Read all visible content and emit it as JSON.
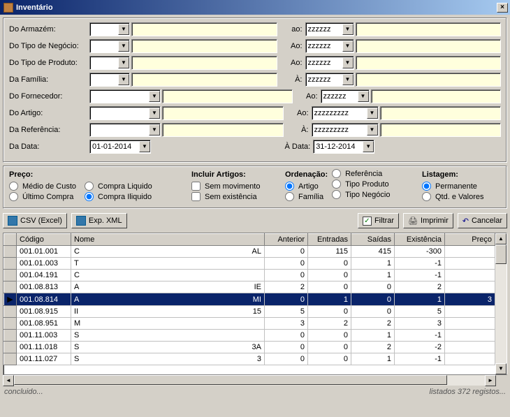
{
  "window": {
    "title": "Inventário"
  },
  "filters": {
    "labels": {
      "armazem": "Do Armazém:",
      "tipo_negocio": "Do Tipo de Negócio:",
      "tipo_produto": "Do Tipo de Produto:",
      "familia": "Da Família:",
      "fornecedor": "Do Fornecedor:",
      "artigo": "Do Artigo:",
      "referencia": "Da Referência:",
      "data_de": "Da Data:",
      "data_a": "À Data:"
    },
    "to_labels": {
      "ao": "ao:",
      "Ao": "Ao:",
      "A": "À:"
    },
    "z6": "zzzzzz",
    "z9": "zzzzzzzzz",
    "data_de_val": "01-01-2014",
    "data_a_val": "31-12-2014"
  },
  "options": {
    "preco": {
      "head": "Preço:",
      "medio": "Médio de Custo",
      "ultimo": "Último Compra",
      "compra_liq": "Compra Liquido",
      "compra_iliq": "Compra Iliquido",
      "selected": "compra_iliq"
    },
    "incluir": {
      "head": "Incluir Artigos:",
      "sem_movimento": "Sem movimento",
      "sem_existencia": "Sem existência"
    },
    "ordenacao": {
      "head": "Ordenação:",
      "artigo": "Artigo",
      "familia": "Família",
      "referencia": "Referência",
      "tipo_produto": "Tipo Produto",
      "tipo_negocio": "Tipo Negócio",
      "selected": "artigo"
    },
    "listagem": {
      "head": "Listagem:",
      "permanente": "Permanente",
      "qtd_val": "Qtd. e Valores",
      "selected": "permanente"
    }
  },
  "buttons": {
    "csv": "CSV (Excel)",
    "xml": "Exp. XML",
    "filtrar": "Filtrar",
    "imprimir": "Imprimir",
    "cancelar": "Cancelar"
  },
  "grid": {
    "columns": [
      "Código",
      "Nome",
      "Anterior",
      "Entradas",
      "Saídas",
      "Existência",
      "Preço"
    ],
    "rows": [
      {
        "codigo": "001.01.001",
        "nome": "C",
        "n2": "AL",
        "anterior": 0,
        "entradas": 115,
        "saidas": 415,
        "existencia": -300,
        "preco": ""
      },
      {
        "codigo": "001.01.003",
        "nome": "T",
        "n2": "",
        "anterior": 0,
        "entradas": 0,
        "saidas": 1,
        "existencia": -1,
        "preco": ""
      },
      {
        "codigo": "001.04.191",
        "nome": "C",
        "n2": "",
        "anterior": 0,
        "entradas": 0,
        "saidas": 1,
        "existencia": -1,
        "preco": ""
      },
      {
        "codigo": "001.08.813",
        "nome": "A",
        "n2": "IE",
        "anterior": 2,
        "entradas": 0,
        "saidas": 0,
        "existencia": 2,
        "preco": ""
      },
      {
        "codigo": "001.08.814",
        "nome": "A",
        "n2": "MI",
        "anterior": 0,
        "entradas": 1,
        "saidas": 0,
        "existencia": 1,
        "preco": "3",
        "selected": true
      },
      {
        "codigo": "001.08.915",
        "nome": "II",
        "n2": "15",
        "anterior": 5,
        "entradas": 0,
        "saidas": 0,
        "existencia": 5,
        "preco": ""
      },
      {
        "codigo": "001.08.951",
        "nome": "M",
        "n2": "",
        "anterior": 3,
        "entradas": 2,
        "saidas": 2,
        "existencia": 3,
        "preco": ""
      },
      {
        "codigo": "001.11.003",
        "nome": "S",
        "n2": "",
        "anterior": 0,
        "entradas": 0,
        "saidas": 1,
        "existencia": -1,
        "preco": ""
      },
      {
        "codigo": "001.11.018",
        "nome": "S",
        "n2": "3A",
        "anterior": 0,
        "entradas": 0,
        "saidas": 2,
        "existencia": -2,
        "preco": ""
      },
      {
        "codigo": "001.11.027",
        "nome": "S",
        "n2": "3",
        "anterior": 0,
        "entradas": 0,
        "saidas": 1,
        "existencia": -1,
        "preco": ""
      }
    ]
  },
  "status": {
    "left": "concluido...",
    "right": "listados 372 registos..."
  }
}
